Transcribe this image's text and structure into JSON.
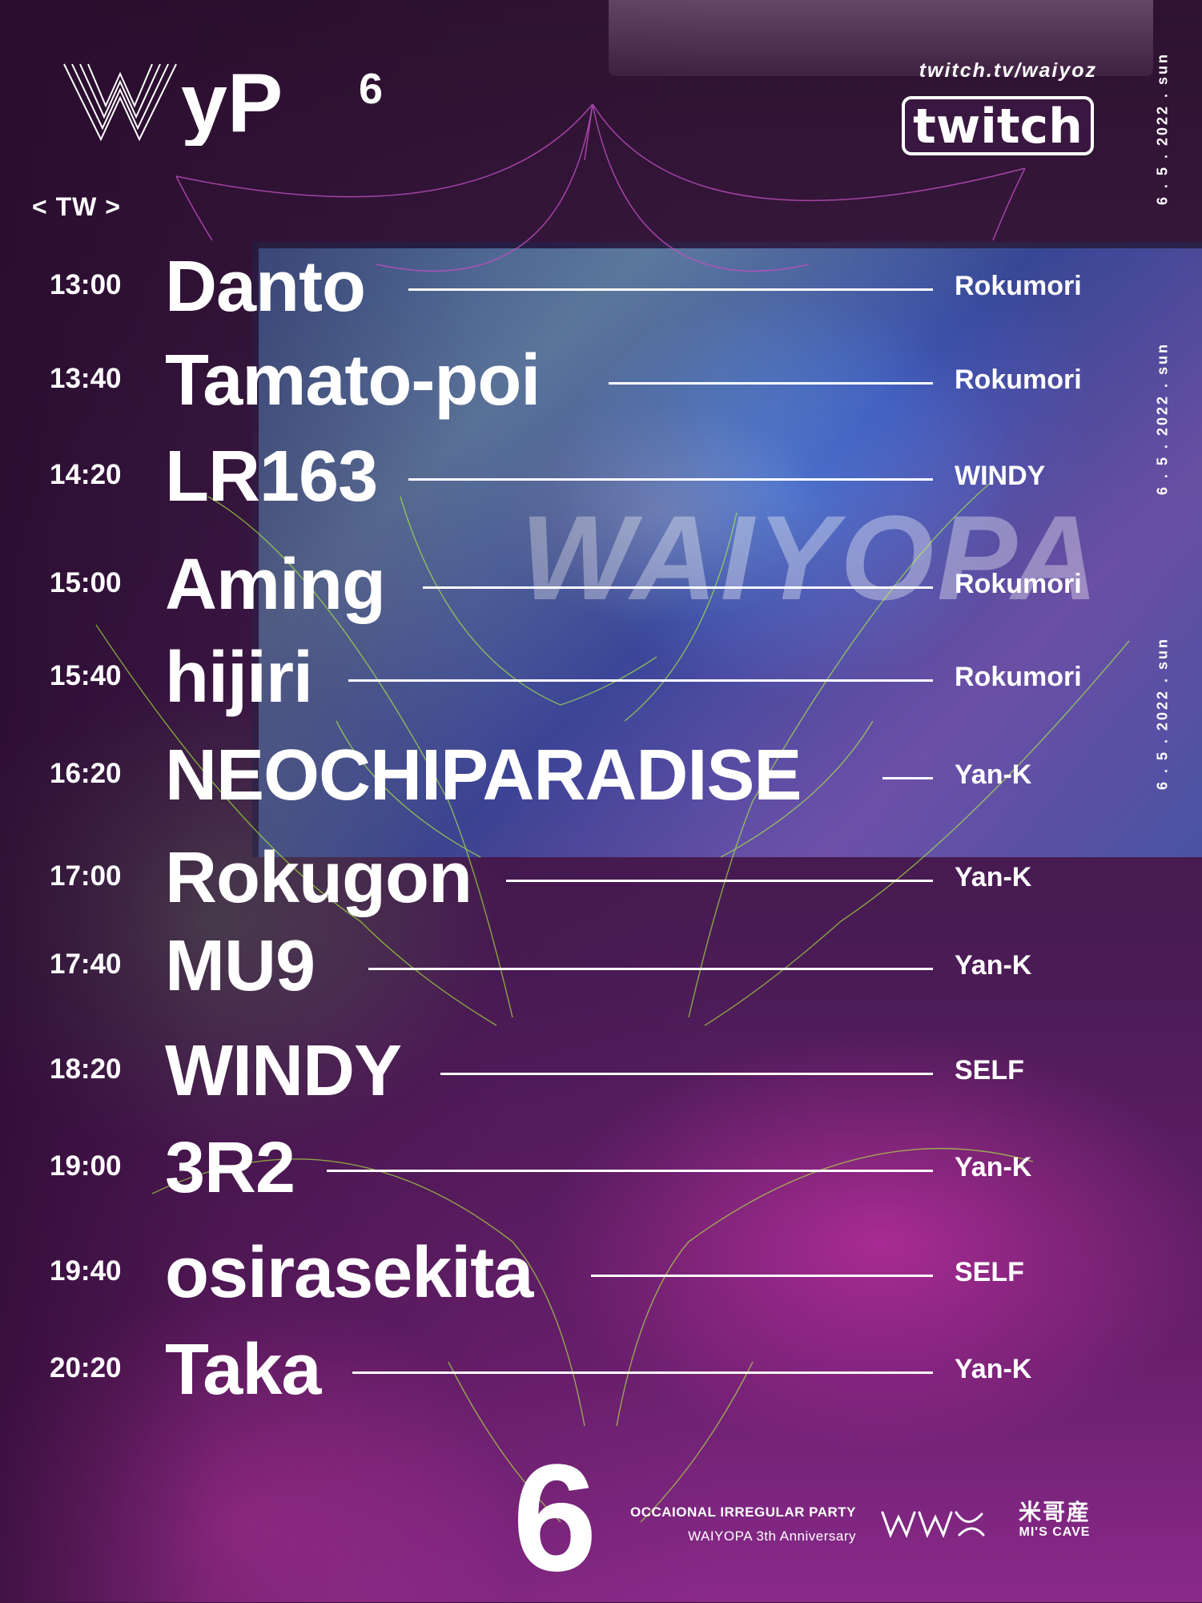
{
  "event": {
    "logo_text": "WyP",
    "edition": "6",
    "platform_url": "twitch.tv/waiyoz",
    "platform_name": "twitch",
    "date_text": "6 . 5 . 2022 . sun",
    "stream_label": "< TW >",
    "footer_number": "6",
    "tagline_1": "OCCAIONAL IRREGULAR PARTY",
    "tagline_2": "WAIYOPA 3th Anniversary",
    "organizer_logo": "waiyopa-logo",
    "venue_kanji": "米哥産",
    "venue_name": "MI'S CAVE"
  },
  "colors": {
    "text": "#ffffff",
    "bg_dark": "#3a1740",
    "neon_pink": "#ff3ed0",
    "deco_green": "#b6ff3c",
    "deco_purple": "#c050c0"
  },
  "timetable": [
    {
      "time": "13:00",
      "artist": "Danto",
      "host": "Rokumori"
    },
    {
      "time": "13:40",
      "artist": "Tamato-poi",
      "host": "Rokumori"
    },
    {
      "time": "14:20",
      "artist": "LR163",
      "host": "WINDY"
    },
    {
      "time": "15:00",
      "artist": "Aming",
      "host": "Rokumori"
    },
    {
      "time": "15:40",
      "artist": "hijiri",
      "host": "Rokumori"
    },
    {
      "time": "16:20",
      "artist": "NEOCHIPARADISE",
      "host": "Yan-K"
    },
    {
      "time": "17:00",
      "artist": "Rokugon",
      "host": "Yan-K"
    },
    {
      "time": "17:40",
      "artist": "MU9",
      "host": "Yan-K"
    },
    {
      "time": "18:20",
      "artist": "WINDY",
      "host": "SELF"
    },
    {
      "time": "19:00",
      "artist": "3R2",
      "host": "Yan-K"
    },
    {
      "time": "19:40",
      "artist": "osirasekita",
      "host": "SELF"
    },
    {
      "time": "20:20",
      "artist": "Taka",
      "host": "Yan-K"
    }
  ]
}
